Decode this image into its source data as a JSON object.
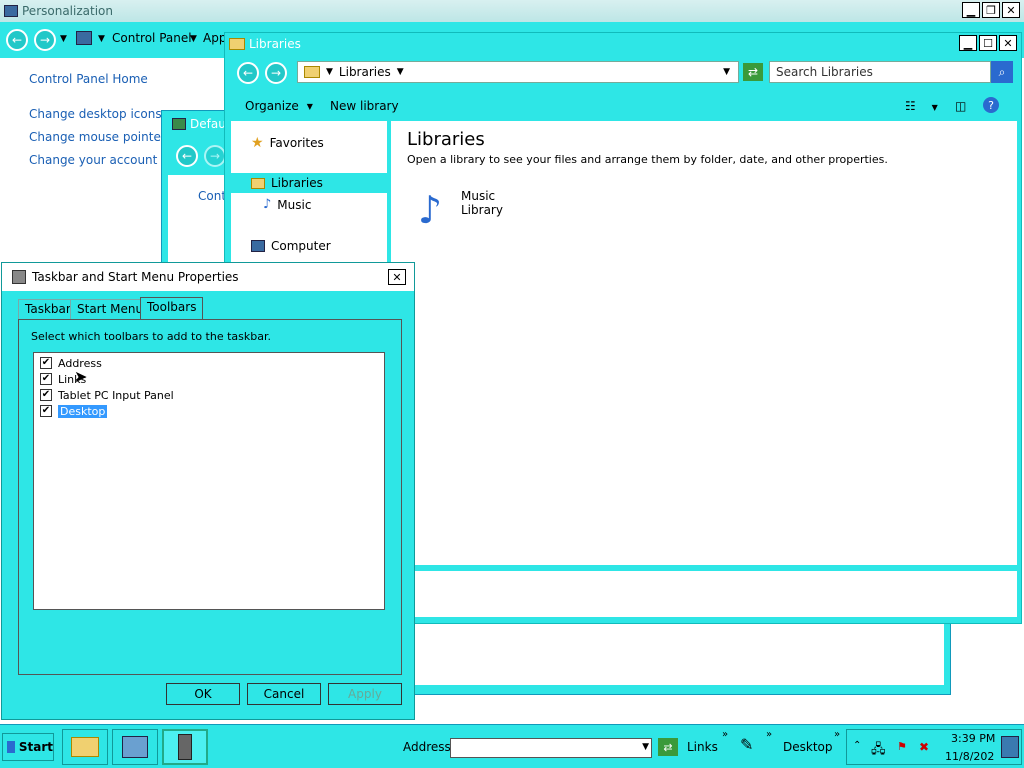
{
  "personalization": {
    "title": "Personalization",
    "breadcrumb": [
      "Control Panel",
      "App"
    ],
    "sidebar": {
      "home": "Control Panel Home",
      "links": [
        "Change desktop icons",
        "Change mouse pointers",
        "Change your account pic"
      ]
    }
  },
  "default_window": {
    "title": "Defau",
    "content": "Cont"
  },
  "libraries_window": {
    "title": "Libraries",
    "address": "Libraries",
    "search_placeholder": "Search Libraries",
    "toolbar": {
      "organize": "Organize",
      "new_library": "New library"
    },
    "nav": {
      "favorites": "Favorites",
      "libraries": "Libraries",
      "music": "Music",
      "computer": "Computer"
    },
    "heading": "Libraries",
    "description": "Open a library to see your files and arrange them by folder, date, and other properties.",
    "items": [
      {
        "line1": "Music",
        "line2": "Library"
      }
    ]
  },
  "dialog": {
    "title": "Taskbar and Start Menu Properties",
    "tabs": [
      "Taskbar",
      "Start Menu",
      "Toolbars"
    ],
    "active_tab": "Toolbars",
    "instruction": "Select which toolbars to add to the taskbar.",
    "toolbars": [
      {
        "label": "Address",
        "checked": true
      },
      {
        "label": "Links",
        "checked": true
      },
      {
        "label": "Tablet PC Input Panel",
        "checked": true
      },
      {
        "label": "Desktop",
        "checked": true
      }
    ],
    "buttons": {
      "ok": "OK",
      "cancel": "Cancel",
      "apply": "Apply"
    }
  },
  "taskbar": {
    "start": "Start",
    "address_label": "Address",
    "links_label": "Links",
    "desktop_label": "Desktop",
    "time": "3:39 PM",
    "date": "11/8/202"
  },
  "colors": {
    "accent": "#2ee6e6",
    "link": "#1a5fb4",
    "selection": "#3399ff"
  }
}
